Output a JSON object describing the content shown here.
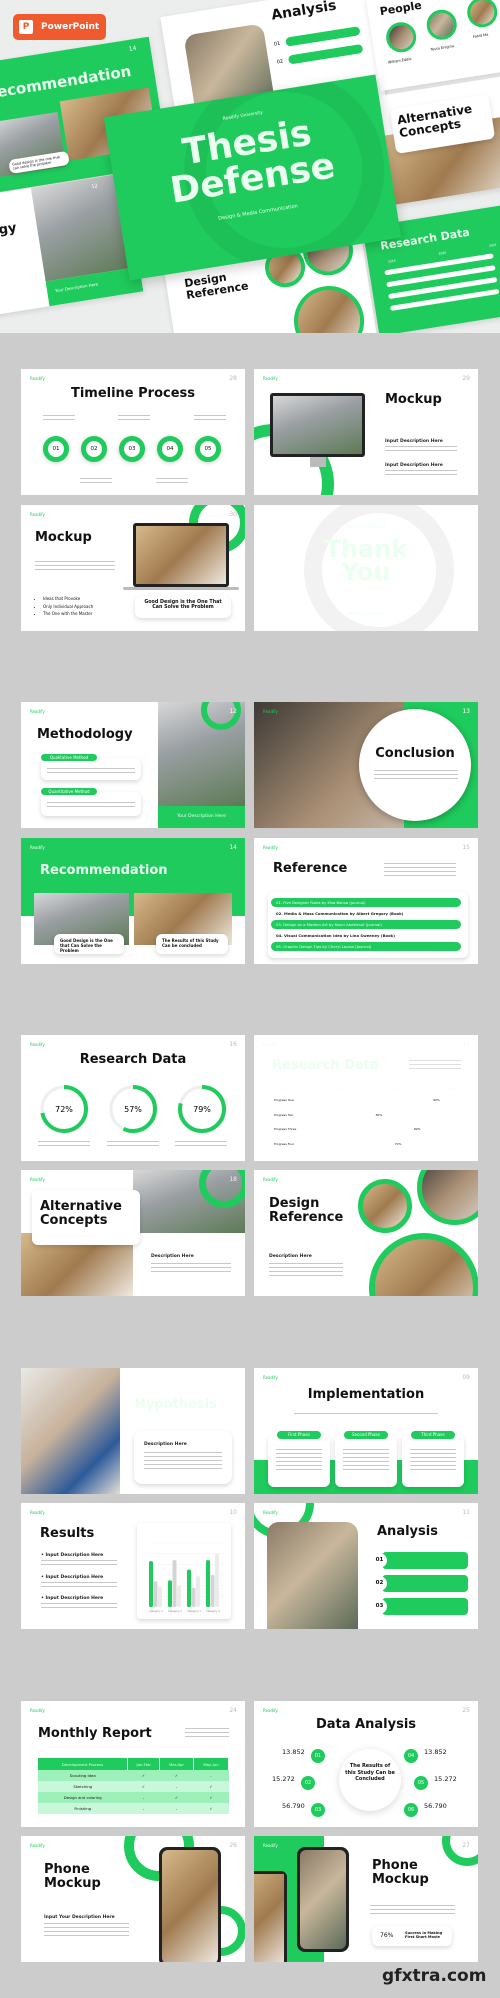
{
  "badge": {
    "label": "PowerPoint",
    "icon": "powerpoint-icon",
    "color": "#ef5a2f"
  },
  "brand": "Readify",
  "accent": "#1fcb5c",
  "hero": {
    "center": {
      "university": "Readify University",
      "title1": "Thesis",
      "title2": "Defense",
      "subtitle": "Design & Media Communication"
    },
    "recommendation": {
      "title": "Recommendation",
      "num": "14",
      "caption": "Good design is the one that can solve the problem"
    },
    "analysis": {
      "title": "Analysis",
      "items": [
        "01",
        "02"
      ]
    },
    "people": {
      "title": "People",
      "names": [
        "William Eddie",
        "Tessa Enigma",
        "Fahid Ma"
      ]
    },
    "alternative": {
      "title1": "Alternative",
      "title2": "Concepts"
    },
    "methodology": {
      "title": "...ogy",
      "num": "12",
      "caption": "Your Description Here"
    },
    "research": {
      "title": "Research Data",
      "years": [
        "2019",
        "2020",
        "2021"
      ]
    },
    "design_reference": {
      "title1": "Design",
      "title2": "Reference",
      "num": "18"
    }
  },
  "slides": {
    "timeline": {
      "title": "Timeline Process",
      "num": "28",
      "steps": [
        "01",
        "02",
        "03",
        "04",
        "05"
      ]
    },
    "mockup29": {
      "title": "Mockup",
      "num": "29",
      "desc1": "Input Description Here",
      "desc2": "Input Description Here"
    },
    "mockup30": {
      "title": "Mockup",
      "num": "30",
      "bullets": [
        "Ideas that Provoke",
        "Only Individual Approach",
        "The One with the Master"
      ],
      "quote": "Good Design is the One That Can Solve the Problem"
    },
    "thankyou": {
      "made_by": "Made by RGBryand",
      "title1": "Thank",
      "title2": "You",
      "university": "Readify University"
    },
    "methodology": {
      "title": "Methodology",
      "num": "12",
      "method1": "Qualitative Method",
      "method2": "Quantitative Method",
      "caption": "Your Description Here"
    },
    "conclusion": {
      "title": "Conclusion",
      "num": "13"
    },
    "recommendation": {
      "title": "Recommendation",
      "num": "14",
      "caption1": "Good Design is the One that Can Solve the Problem",
      "caption2": "The Results of this Study Can be concluded"
    },
    "reference": {
      "title": "Reference",
      "num": "15",
      "items": [
        "01. Five Designer Rules by Elsa Bansa (Journal)",
        "02. Media & Mass Communication by Albert Gregory (Book)",
        "03. Design as a Modern Art by Nouri Abdelrauf (Journal)",
        "04. Visual Communication Idea by Lina Sweeney (Book)",
        "05. Graphic Design Tips by Cheryl Louisa (Journal)"
      ]
    },
    "research16": {
      "title": "Research Data",
      "num": "16",
      "rings": [
        {
          "label": "72%",
          "value": 72
        },
        {
          "label": "57%",
          "value": 57
        },
        {
          "label": "79%",
          "value": 79
        }
      ]
    },
    "research17": {
      "title": "Research Data",
      "num": "17",
      "years": [
        "2019",
        "2020",
        "2021",
        "2022"
      ],
      "bars": [
        {
          "label": "Progress One",
          "pct": "90%",
          "value": 90
        },
        {
          "label": "Progress Two",
          "pct": "60%",
          "value": 60
        },
        {
          "label": "Progress Three",
          "pct": "80%",
          "value": 80
        },
        {
          "label": "Progress Four",
          "pct": "70%",
          "value": 70
        }
      ]
    },
    "alternative": {
      "title1": "Alternative",
      "title2": "Concepts",
      "num": "18",
      "desc": "Description Here"
    },
    "design_reference": {
      "title1": "Design",
      "title2": "Reference",
      "desc": "Description Here"
    },
    "hypothesis": {
      "title": "Hypothesis",
      "num": "08",
      "desc": "Description Here"
    },
    "implementation": {
      "title": "Implementation",
      "num": "09",
      "phases": [
        "First Phase",
        "Second Phase",
        "Third Phase"
      ]
    },
    "results": {
      "title": "Results",
      "num": "10",
      "items": [
        "Input Description Here",
        "Input Description Here",
        "Input Description Here"
      ],
      "chart": {
        "type": "bar",
        "categories": [
          "Category 1",
          "Category 2",
          "Category 3",
          "Category 4"
        ],
        "ylim": [
          0,
          6
        ],
        "series": [
          {
            "values": [
              4.3,
              2.5,
              3.5,
              4.4
            ],
            "color": "#1fcb5c"
          },
          {
            "values": [
              2.4,
              4.4,
              1.8,
              3.0
            ],
            "color": "#d4d4d4"
          },
          {
            "values": [
              1.9,
              2.0,
              2.9,
              5.0
            ],
            "color": "#ececec"
          }
        ]
      }
    },
    "analysis": {
      "title": "Analysis",
      "num": "11",
      "items": [
        "01",
        "02",
        "03"
      ]
    },
    "monthly": {
      "title": "Monthly Report",
      "num": "24",
      "headers": [
        "Development Process",
        "Jan-Feb",
        "Mar-Apr",
        "May-Jun"
      ],
      "rows": [
        [
          "Scouting Idea",
          "✓",
          "✓",
          "-"
        ],
        [
          "Sketching",
          "✓",
          "-",
          "✓"
        ],
        [
          "Design and coloring",
          "-",
          "✓",
          "✓"
        ],
        [
          "Finishing",
          "-",
          "-",
          "✓"
        ]
      ]
    },
    "data_analysis": {
      "title": "Data Analysis",
      "num": "25",
      "center": "The Results of this Study Can be Concluded",
      "left": [
        {
          "value": "13.852",
          "n": "01"
        },
        {
          "value": "15.272",
          "n": "02"
        },
        {
          "value": "56.790",
          "n": "03"
        }
      ],
      "right": [
        {
          "value": "13.852",
          "n": "04"
        },
        {
          "value": "15.272",
          "n": "05"
        },
        {
          "value": "56.790",
          "n": "06"
        }
      ]
    },
    "phone26": {
      "title1": "Phone",
      "title2": "Mockup",
      "num": "26",
      "desc": "Input Your Description Here"
    },
    "phone27": {
      "title1": "Phone",
      "title2": "Mockup",
      "num": "27",
      "stat": "76%",
      "stat_label": "Success in Making First Short Movie"
    }
  },
  "watermark": "gfxtra.com"
}
